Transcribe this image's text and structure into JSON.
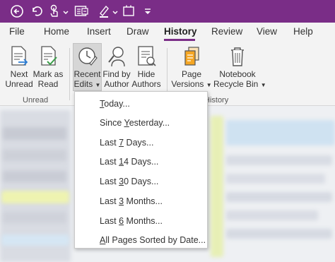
{
  "quick_access": {
    "icons": [
      "back-icon",
      "undo-icon",
      "touch-icon",
      "chevron-down-icon",
      "dock-icon",
      "pen-icon",
      "chevron-down-icon",
      "full-page-icon",
      "customize-icon"
    ]
  },
  "tabs": [
    "File",
    "Home",
    "Insert",
    "Draw",
    "History",
    "Review",
    "View",
    "Help"
  ],
  "active_tab": "History",
  "ribbon": {
    "unread_group": {
      "label": "Unread",
      "next_unread": {
        "line1": "Next",
        "line2": "Unread"
      },
      "mark_as_read": {
        "line1": "Mark as",
        "line2": "Read"
      }
    },
    "authors_group": {
      "recent_edits": {
        "line1": "Recent",
        "line2": "Edits"
      },
      "find_by_author": {
        "line1": "Find by",
        "line2": "Author"
      },
      "hide_authors": {
        "line1": "Hide",
        "line2": "Authors"
      }
    },
    "history_group": {
      "label": "History",
      "page_versions": {
        "line1": "Page",
        "line2": "Versions"
      },
      "recycle_bin": {
        "line1": "Notebook",
        "line2": "Recycle Bin"
      }
    }
  },
  "menu": {
    "items": [
      "Today...",
      "Since Yesterday...",
      "Last 7 Days...",
      "Last 14 Days...",
      "Last 30 Days...",
      "Last 3 Months...",
      "Last 6 Months...",
      "All Pages Sorted by Date..."
    ],
    "access_keys": [
      "T",
      "Y",
      "7",
      "1",
      "3",
      "3",
      "6",
      "A"
    ]
  },
  "colors": {
    "title_bar": "#7a2d87",
    "ribbon": "#f3f3f3",
    "accent": "#7a2d87"
  }
}
